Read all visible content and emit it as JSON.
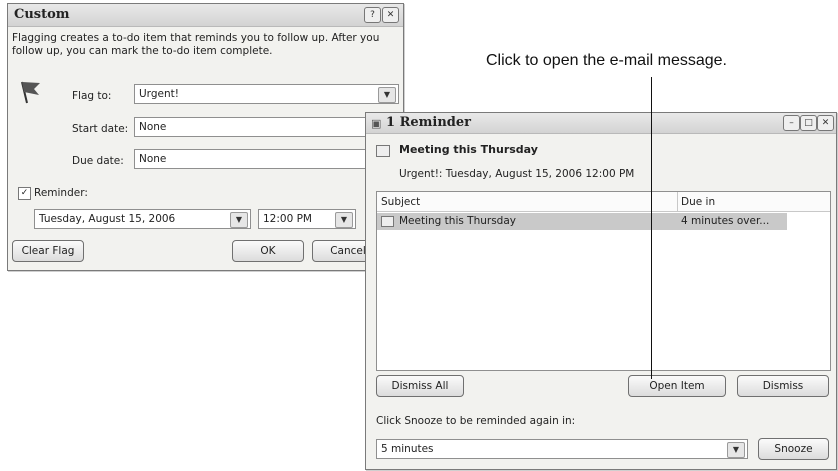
{
  "callout": {
    "text": "Click to open the e-mail message."
  },
  "custom_dialog": {
    "title": "Custom",
    "help_btn": "?",
    "close_btn": "✕",
    "description": "Flagging creates a to-do item that reminds you to follow up. After you follow up, you can mark the to-do item complete.",
    "flag_to_label": "Flag to:",
    "flag_to_value": "Urgent!",
    "start_date_label": "Start date:",
    "start_date_value": "None",
    "due_date_label": "Due date:",
    "due_date_value": "None",
    "reminder_label": "Reminder:",
    "reminder_checked": true,
    "reminder_date": "Tuesday, August 15, 2006",
    "reminder_time": "12:00 PM",
    "clear_flag_button": "Clear Flag",
    "ok_button": "OK",
    "cancel_button": "Cancel"
  },
  "reminder_window": {
    "title": "1 Reminder",
    "item_title": "Meeting this Thursday",
    "item_detail": "Urgent!: Tuesday, August 15, 2006 12:00 PM",
    "columns": [
      "Subject",
      "Due in"
    ],
    "rows": [
      {
        "subject": "Meeting this Thursday",
        "due_in": "4 minutes over..."
      }
    ],
    "dismiss_all_button": "Dismiss All",
    "open_item_button": "Open Item",
    "dismiss_button": "Dismiss",
    "snooze_prompt": "Click Snooze to be reminded again in:",
    "snooze_value": "5 minutes",
    "snooze_button": "Snooze"
  }
}
